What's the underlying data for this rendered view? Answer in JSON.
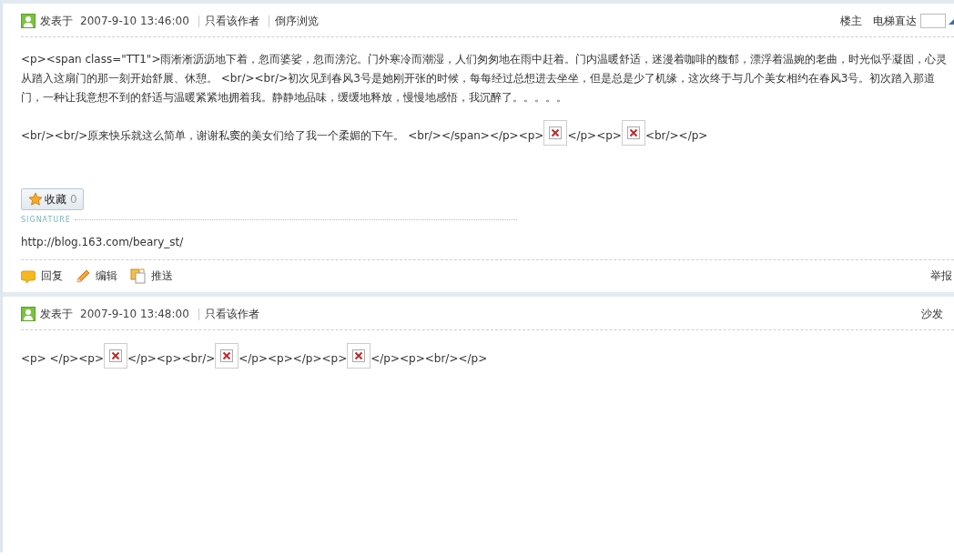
{
  "posts": [
    {
      "posted_label": "发表于",
      "time": "2007-9-10 13:46:00",
      "links": [
        "只看该作者",
        "倒序浏览"
      ],
      "floor": "楼主",
      "jump_label": "电梯直达",
      "paragraphs": [
        [
          {
            "kind": "text",
            "text": "<p><span class=\"TT1\">雨淅淅沥沥地下着，忽而婆娑，忽而滂沱。门外寒冷而潮湿，人们匆匆地在雨中赶着。门内温暖舒适，迷漫着咖啡的馥郁，漂浮着温婉的老曲，时光似乎凝固，心灵从踏入这扇门的那一刻开始舒展、休憩。 <br/><br/>初次见到春风3号是她刚开张的时候，每每经过总想进去坐坐，但是总是少了机缘，这次终于与几个美女相约在春风3号。初次踏入那道门，一种让我意想不到的舒适与温暖紧紧地拥着我。静静地品味，缓缓地释放，慢慢地感悟，我沉醉了。。。。。"
          }
        ],
        [
          {
            "kind": "text",
            "text": "<br/><br/>原来快乐就这么简单，谢谢私窦的美女们给了我一个柔媚的下午。 <br/></span></p><p>"
          },
          {
            "kind": "broken-image"
          },
          {
            "kind": "text",
            "text": "</p><p>"
          },
          {
            "kind": "broken-image"
          },
          {
            "kind": "text",
            "text": "<br/></p>"
          }
        ]
      ],
      "favorite": {
        "label": "收藏",
        "count": "0"
      },
      "signature": {
        "heading": "SIGNATURE",
        "text": "http://blog.163.com/beary_st/"
      },
      "actions": [
        {
          "kind": "reply",
          "label": "回复"
        },
        {
          "kind": "edit",
          "label": "编辑"
        },
        {
          "kind": "push",
          "label": "推送"
        }
      ],
      "report": "举报"
    },
    {
      "posted_label": "发表于",
      "time": "2007-9-10 13:48:00",
      "links": [
        "只看该作者"
      ],
      "floor": "沙发",
      "paragraphs": [
        [
          {
            "kind": "text",
            "text": "<p> </p><p>"
          },
          {
            "kind": "broken-image"
          },
          {
            "kind": "text",
            "text": "</p><p><br/>"
          },
          {
            "kind": "broken-image"
          },
          {
            "kind": "text",
            "text": "</p><p></p><p>"
          },
          {
            "kind": "broken-image"
          },
          {
            "kind": "text",
            "text": "</p><p><br/></p>"
          }
        ]
      ]
    }
  ]
}
